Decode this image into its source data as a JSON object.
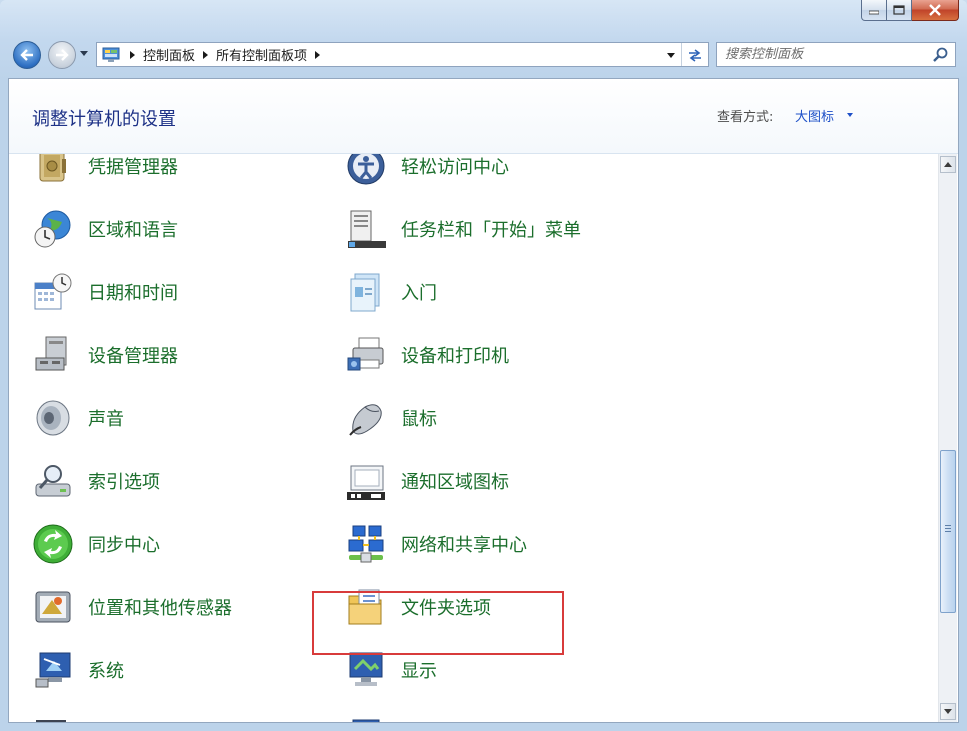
{
  "window": {
    "caption_buttons": [
      "minimize",
      "maximize",
      "close"
    ]
  },
  "address": {
    "crumbs": [
      "控制面板",
      "所有控制面板项"
    ]
  },
  "search": {
    "placeholder": "搜索控制面板"
  },
  "header": {
    "title": "调整计算机的设置",
    "view_label": "查看方式:",
    "view_value": "大图标"
  },
  "items": [
    {
      "label": "凭据管理器",
      "icon": "credential-vault-icon"
    },
    {
      "label": "轻松访问中心",
      "icon": "ease-of-access-icon"
    },
    {
      "label": "区域和语言",
      "icon": "globe-clock-icon"
    },
    {
      "label": "任务栏和「开始」菜单",
      "icon": "taskbar-icon"
    },
    {
      "label": "日期和时间",
      "icon": "calendar-clock-icon"
    },
    {
      "label": "入门",
      "icon": "getting-started-icon"
    },
    {
      "label": "设备管理器",
      "icon": "device-manager-icon"
    },
    {
      "label": "设备和打印机",
      "icon": "printer-icon"
    },
    {
      "label": "声音",
      "icon": "speaker-icon"
    },
    {
      "label": "鼠标",
      "icon": "mouse-icon"
    },
    {
      "label": "索引选项",
      "icon": "indexing-icon"
    },
    {
      "label": "通知区域图标",
      "icon": "notification-area-icon"
    },
    {
      "label": "同步中心",
      "icon": "sync-center-icon"
    },
    {
      "label": "网络和共享中心",
      "icon": "network-sharing-icon"
    },
    {
      "label": "位置和其他传感器",
      "icon": "location-sensor-icon"
    },
    {
      "label": "文件夹选项",
      "icon": "folder-options-icon"
    },
    {
      "label": "系统",
      "icon": "system-icon"
    },
    {
      "label": "显示",
      "icon": "display-icon"
    }
  ],
  "colors": {
    "item_label": "#1b6e2c",
    "title": "#1e3287",
    "link": "#1e50c8",
    "highlight": "#d83b3b"
  }
}
